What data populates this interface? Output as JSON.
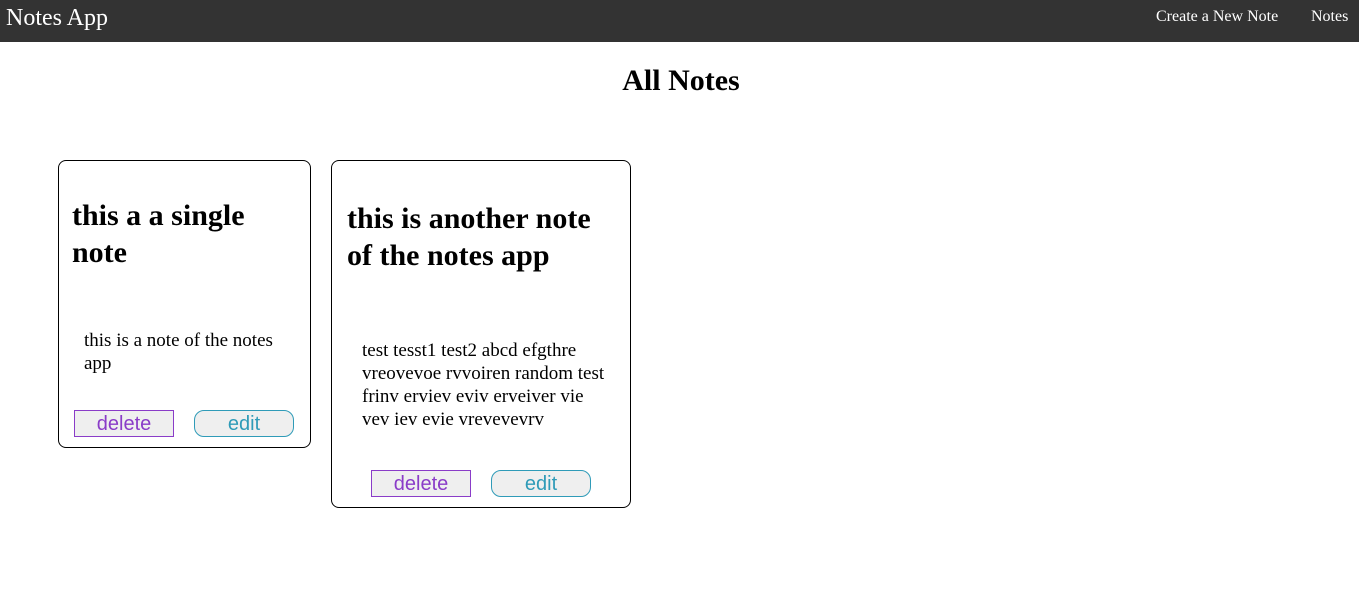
{
  "navbar": {
    "brand": "Notes App",
    "links": [
      {
        "label": "Create a New Note"
      },
      {
        "label": "Notes"
      }
    ]
  },
  "page": {
    "title": "All Notes"
  },
  "notes": [
    {
      "title": "this a a single note",
      "body": "this is a note of the notes app",
      "delete_label": "delete",
      "edit_label": "edit"
    },
    {
      "title": "this is another note of the notes app",
      "body": "test tesst1 test2 abcd efgthre vreovevoe rvvoiren random test frinv erviev eviv erveiver vie vev iev evie vrevevevrv",
      "delete_label": "delete",
      "edit_label": "edit"
    }
  ],
  "colors": {
    "navbar_bg": "#333333",
    "delete": "#8a3cc8",
    "edit": "#2f9bb8"
  }
}
